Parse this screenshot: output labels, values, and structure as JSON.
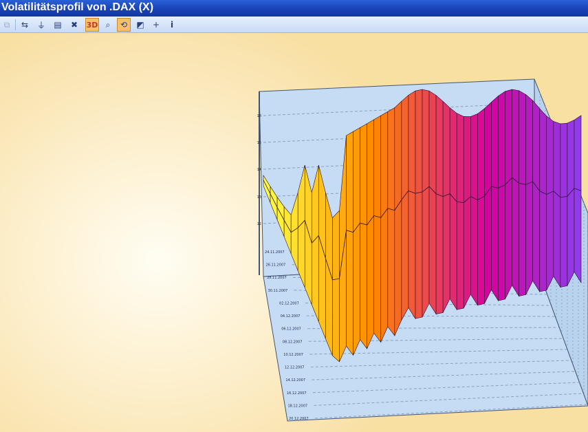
{
  "window": {
    "title": "Volatilitätsprofil von .DAX (X)"
  },
  "toolbar": {
    "items": [
      {
        "name": "copy-icon",
        "glyph": "⧉",
        "state": "disabled"
      },
      {
        "name": "swap-icon",
        "glyph": "⇆",
        "state": "normal"
      },
      {
        "name": "filter-icon",
        "glyph": "⏚",
        "state": "normal"
      },
      {
        "name": "notes-icon",
        "glyph": "▤",
        "state": "normal"
      },
      {
        "name": "delete-icon",
        "glyph": "✖",
        "state": "normal"
      },
      {
        "name": "3d-button",
        "label": "3D",
        "state": "active"
      },
      {
        "name": "zoom-icon",
        "glyph": "⌕",
        "state": "normal"
      },
      {
        "name": "rotate-icon",
        "glyph": "⟲",
        "state": "active"
      },
      {
        "name": "surface-icon",
        "glyph": "◩",
        "state": "normal"
      },
      {
        "name": "crosshair-icon",
        "glyph": "+",
        "state": "normal"
      },
      {
        "name": "info-icon",
        "glyph": "i",
        "state": "normal"
      }
    ]
  },
  "chart_data": {
    "type": "surface",
    "title": "",
    "z_tick_labels": [
      "18",
      "15",
      "14",
      "13",
      "12"
    ],
    "date_tick_labels": [
      "24.11.2007",
      "26.11.2007",
      "28.11.2007",
      "30.11.2007",
      "02.12.2007",
      "04.12.2007",
      "06.12.2007",
      "08.12.2007",
      "10.12.2007",
      "12.12.2007",
      "14.12.2007",
      "16.12.2007",
      "18.12.2007",
      "20.12.2007"
    ],
    "colors": {
      "wall": "#c6dcf4",
      "wall_edge": "#44546e",
      "low": "#ffff40",
      "mid": "#ff8a00",
      "high": "#d600a0",
      "top": "#8a40f0"
    },
    "grid": true
  }
}
